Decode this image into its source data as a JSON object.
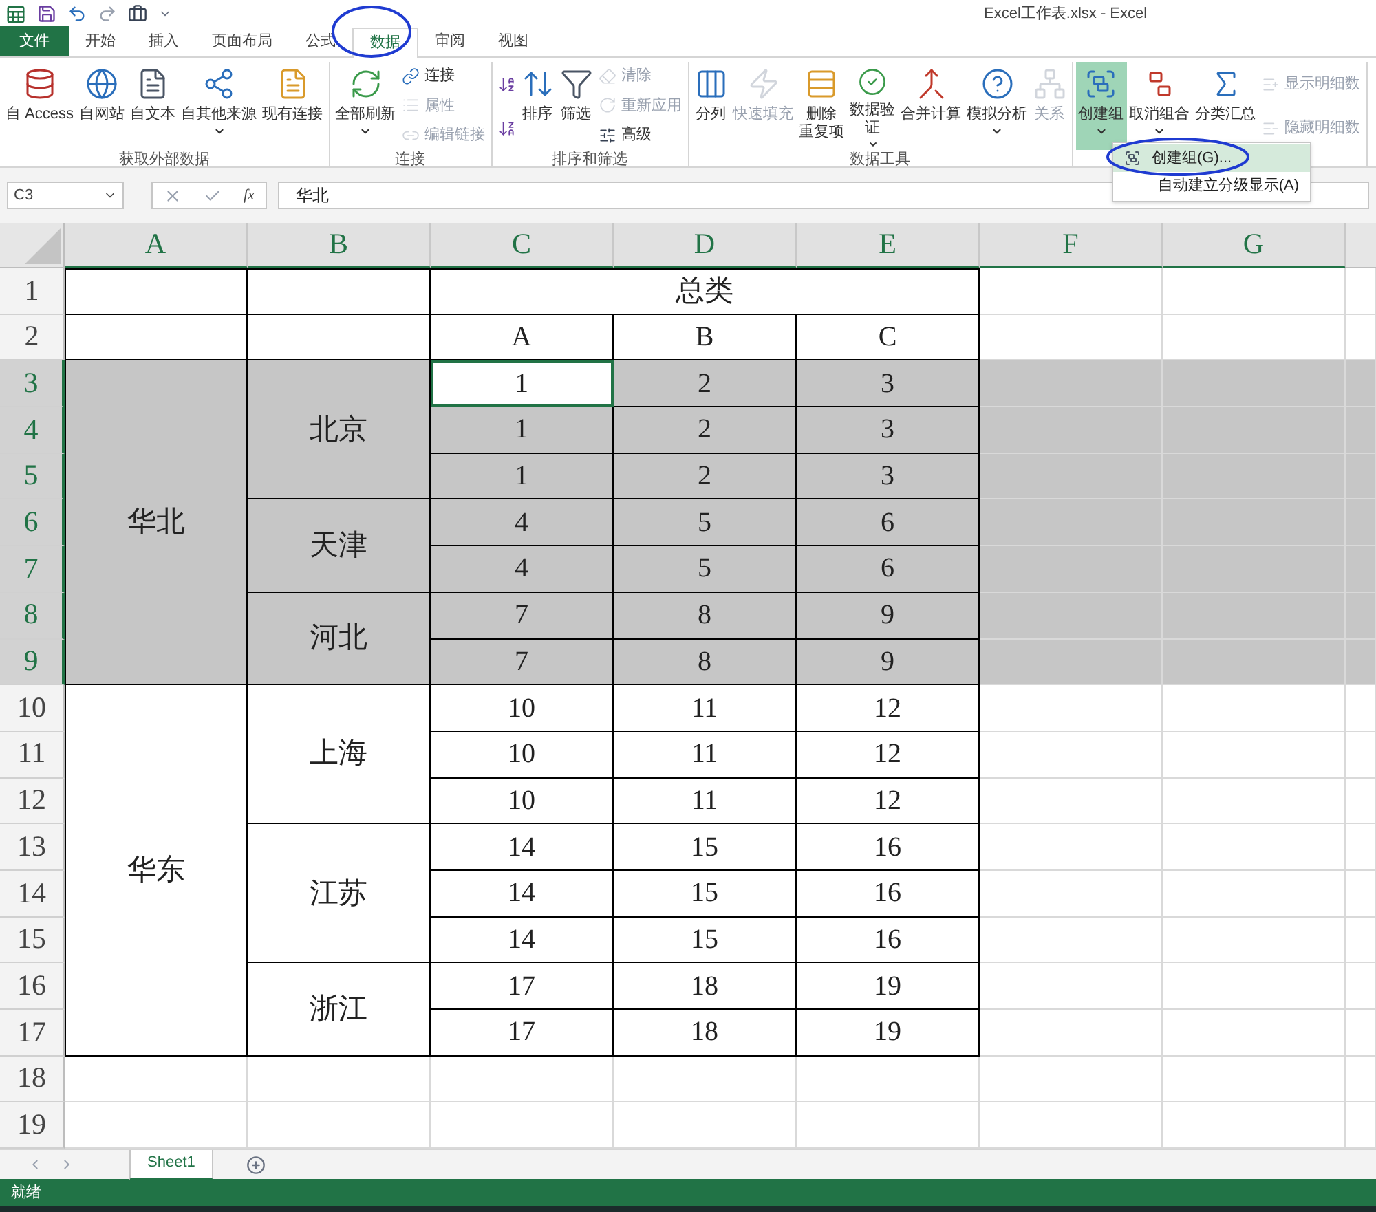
{
  "window": {
    "title": "Excel工作表.xlsx - Excel"
  },
  "tabs": [
    {
      "label": "文件",
      "kind": "file",
      "selected": false
    },
    {
      "label": "开始",
      "kind": "tab",
      "selected": false
    },
    {
      "label": "插入",
      "kind": "tab",
      "selected": false
    },
    {
      "label": "页面布局",
      "kind": "tab",
      "selected": false
    },
    {
      "label": "公式",
      "kind": "tab",
      "selected": false
    },
    {
      "label": "数据",
      "kind": "tab",
      "selected": true
    },
    {
      "label": "审阅",
      "kind": "tab",
      "selected": false
    },
    {
      "label": "视图",
      "kind": "tab",
      "selected": false
    }
  ],
  "ribbon": [
    {
      "label": "获取外部数据",
      "items": [
        {
          "label": "自 Access",
          "kind": "large",
          "dropdown": false,
          "disabled": false,
          "pressed": false
        },
        {
          "label": "自网站",
          "kind": "large",
          "dropdown": false,
          "disabled": false,
          "pressed": false
        },
        {
          "label": "自文本",
          "kind": "large",
          "dropdown": false,
          "disabled": false,
          "pressed": false
        },
        {
          "label": "自其他来源",
          "kind": "large",
          "dropdown": true,
          "disabled": false,
          "pressed": false
        },
        {
          "label": "现有连接",
          "kind": "large",
          "dropdown": false,
          "disabled": false,
          "pressed": false
        }
      ]
    },
    {
      "label": "连接",
      "items": [
        {
          "label": "全部刷新",
          "kind": "large",
          "dropdown": true,
          "disabled": false,
          "pressed": false
        },
        {
          "label": "连接",
          "kind": "small",
          "dropdown": false,
          "disabled": false,
          "pressed": false
        },
        {
          "label": "属性",
          "kind": "small",
          "dropdown": false,
          "disabled": true,
          "pressed": false
        },
        {
          "label": "编辑链接",
          "kind": "small",
          "dropdown": false,
          "disabled": true,
          "pressed": false
        }
      ]
    },
    {
      "label": "排序和筛选",
      "items": [
        {
          "kind": "small",
          "dropdown": false,
          "disabled": false,
          "pressed": false
        },
        {
          "kind": "small",
          "dropdown": false,
          "disabled": false,
          "pressed": false
        },
        {
          "label": "排序",
          "kind": "large",
          "dropdown": false,
          "disabled": false,
          "pressed": false
        },
        {
          "label": "筛选",
          "kind": "large",
          "dropdown": false,
          "disabled": false,
          "pressed": false
        },
        {
          "label": "清除",
          "kind": "small",
          "dropdown": false,
          "disabled": true,
          "pressed": false
        },
        {
          "label": "重新应用",
          "kind": "small",
          "dropdown": false,
          "disabled": true,
          "pressed": false
        },
        {
          "label": "高级",
          "kind": "small",
          "dropdown": false,
          "disabled": false,
          "pressed": false
        }
      ]
    },
    {
      "label": "数据工具",
      "items": [
        {
          "label": "分列",
          "kind": "large",
          "dropdown": false,
          "disabled": false,
          "pressed": false
        },
        {
          "label": "快速填充",
          "kind": "large",
          "dropdown": false,
          "disabled": true,
          "pressed": false
        },
        {
          "lines": [
            "删除",
            "重复项"
          ],
          "kind": "large",
          "dropdown": false,
          "disabled": false,
          "pressed": false
        },
        {
          "lines": [
            "数据验",
            "证"
          ],
          "kind": "large",
          "dropdown": true,
          "disabled": false,
          "pressed": false
        },
        {
          "label": "合并计算",
          "kind": "large",
          "dropdown": false,
          "disabled": false,
          "pressed": false
        },
        {
          "label": "模拟分析",
          "kind": "large",
          "dropdown": true,
          "disabled": false,
          "pressed": false
        },
        {
          "label": "关系",
          "kind": "large",
          "dropdown": false,
          "disabled": true,
          "pressed": false
        }
      ]
    },
    {
      "items": [
        {
          "label": "创建组",
          "kind": "large",
          "dropdown": true,
          "disabled": false,
          "pressed": true
        },
        {
          "label": "取消组合",
          "kind": "large",
          "dropdown": true,
          "disabled": false,
          "pressed": false
        },
        {
          "label": "分类汇总",
          "kind": "large",
          "dropdown": false,
          "disabled": false,
          "pressed": false
        },
        {
          "label": "显示明细数",
          "kind": "small",
          "dropdown": false,
          "disabled": true,
          "pressed": false
        },
        {
          "label": "隐藏明细数",
          "kind": "small",
          "dropdown": false,
          "disabled": true,
          "pressed": false
        }
      ]
    }
  ],
  "menu": {
    "items": [
      {
        "label": "创建组(G)...",
        "selected": true
      },
      {
        "label": "自动建立分级显示(A)",
        "selected": false
      }
    ]
  },
  "formula_bar": {
    "name_box": "C3",
    "fx": "fx",
    "value": "华北"
  },
  "column_headers": [
    {
      "label": "A",
      "selected": true
    },
    {
      "label": "B",
      "selected": true
    },
    {
      "label": "C",
      "selected": true
    },
    {
      "label": "D",
      "selected": true
    },
    {
      "label": "E",
      "selected": true
    },
    {
      "label": "F",
      "selected": true
    },
    {
      "label": "G",
      "selected": true
    }
  ],
  "row_headers": [
    {
      "label": "1",
      "selected": false
    },
    {
      "label": "2",
      "selected": false
    },
    {
      "label": "3",
      "selected": true
    },
    {
      "label": "4",
      "selected": true
    },
    {
      "label": "5",
      "selected": true
    },
    {
      "label": "6",
      "selected": true
    },
    {
      "label": "7",
      "selected": true
    },
    {
      "label": "8",
      "selected": true
    },
    {
      "label": "9",
      "selected": true
    },
    {
      "label": "10",
      "selected": false
    },
    {
      "label": "11",
      "selected": false
    },
    {
      "label": "12",
      "selected": false
    },
    {
      "label": "13",
      "selected": false
    },
    {
      "label": "14",
      "selected": false
    },
    {
      "label": "15",
      "selected": false
    },
    {
      "label": "16",
      "selected": false
    },
    {
      "label": "17",
      "selected": false
    },
    {
      "label": "18",
      "selected": false
    },
    {
      "label": "19",
      "selected": false
    }
  ],
  "table": {
    "title": "总类",
    "columns": [
      "A",
      "B",
      "C"
    ],
    "regions": [
      {
        "name": "华北",
        "cities": [
          {
            "name": "北京",
            "rows": [
              [
                {
                  "text": "1",
                  "active": true
                },
                {
                  "text": "2",
                  "active": false
                },
                {
                  "text": "3",
                  "active": false
                }
              ],
              [
                {
                  "text": "1",
                  "active": false
                },
                {
                  "text": "2",
                  "active": false
                },
                {
                  "text": "3",
                  "active": false
                }
              ],
              [
                {
                  "text": "1",
                  "active": false
                },
                {
                  "text": "2",
                  "active": false
                },
                {
                  "text": "3",
                  "active": false
                }
              ]
            ]
          },
          {
            "name": "天津",
            "rows": [
              [
                {
                  "text": "4",
                  "active": false
                },
                {
                  "text": "5",
                  "active": false
                },
                {
                  "text": "6",
                  "active": false
                }
              ],
              [
                {
                  "text": "4",
                  "active": false
                },
                {
                  "text": "5",
                  "active": false
                },
                {
                  "text": "6",
                  "active": false
                }
              ]
            ]
          },
          {
            "name": "河北",
            "rows": [
              [
                {
                  "text": "7",
                  "active": false
                },
                {
                  "text": "8",
                  "active": false
                },
                {
                  "text": "9",
                  "active": false
                }
              ],
              [
                {
                  "text": "7",
                  "active": false
                },
                {
                  "text": "8",
                  "active": false
                },
                {
                  "text": "9",
                  "active": false
                }
              ]
            ]
          }
        ]
      },
      {
        "name": "华东",
        "cities": [
          {
            "name": "上海",
            "rows": [
              [
                {
                  "text": "10",
                  "active": false
                },
                {
                  "text": "11",
                  "active": false
                },
                {
                  "text": "12",
                  "active": false
                }
              ],
              [
                {
                  "text": "10",
                  "active": false
                },
                {
                  "text": "11",
                  "active": false
                },
                {
                  "text": "12",
                  "active": false
                }
              ],
              [
                {
                  "text": "10",
                  "active": false
                },
                {
                  "text": "11",
                  "active": false
                },
                {
                  "text": "12",
                  "active": false
                }
              ]
            ]
          },
          {
            "name": "江苏",
            "rows": [
              [
                {
                  "text": "14",
                  "active": false
                },
                {
                  "text": "15",
                  "active": false
                },
                {
                  "text": "16",
                  "active": false
                }
              ],
              [
                {
                  "text": "14",
                  "active": false
                },
                {
                  "text": "15",
                  "active": false
                },
                {
                  "text": "16",
                  "active": false
                }
              ],
              [
                {
                  "text": "14",
                  "active": false
                },
                {
                  "text": "15",
                  "active": false
                },
                {
                  "text": "16",
                  "active": false
                }
              ]
            ]
          },
          {
            "name": "浙江",
            "rows": [
              [
                {
                  "text": "17",
                  "active": false
                },
                {
                  "text": "18",
                  "active": false
                },
                {
                  "text": "19",
                  "active": false
                }
              ],
              [
                {
                  "text": "17",
                  "active": false
                },
                {
                  "text": "18",
                  "active": false
                },
                {
                  "text": "19",
                  "active": false
                }
              ]
            ]
          }
        ]
      }
    ]
  },
  "sheet_tabs": [
    {
      "label": "Sheet1",
      "selected": true
    }
  ],
  "status_bar": {
    "text": "就绪"
  }
}
